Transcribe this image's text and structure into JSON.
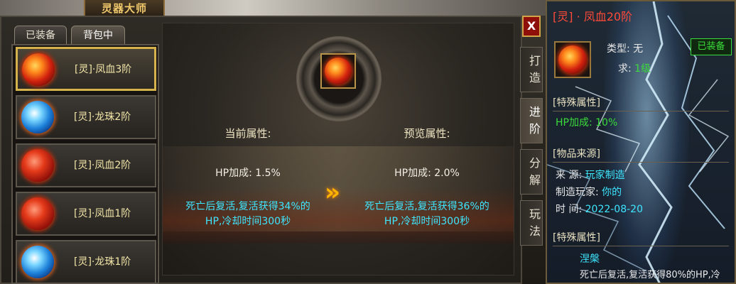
{
  "window": {
    "title": "灵器大师",
    "close_label": "X"
  },
  "tabs": [
    {
      "label": "已装备"
    },
    {
      "label": "背包中"
    }
  ],
  "items": [
    {
      "name": "[灵]·凤血3阶",
      "orb": "red"
    },
    {
      "name": "[灵]·龙珠2阶",
      "orb": "blue"
    },
    {
      "name": "[灵]·凤血2阶",
      "orb": "red"
    },
    {
      "name": "[灵]·凤血1阶",
      "orb": "red"
    },
    {
      "name": "[灵]·龙珠1阶",
      "orb": "blue"
    }
  ],
  "upgrade": {
    "current_header": "当前属性:",
    "preview_header": "预览属性:",
    "current_hp": "HP加成: 1.5%",
    "preview_hp": "HP加成: 2.0%",
    "current_desc_1": "死亡后复活,复活获得34%的",
    "current_desc_2": "HP,冷却时间300秒",
    "preview_desc_1": "死亡后复活,复活获得36%的",
    "preview_desc_2": "HP,冷却时间300秒",
    "arrow": "»"
  },
  "side_menu": [
    "打造",
    "进阶",
    "分解",
    "玩法"
  ],
  "tooltip": {
    "title": "[灵] · 凤血20阶",
    "type_label": "类型: 无",
    "level_prefix": "求: ",
    "level_value": "1级",
    "equipped": "已装备",
    "special_header": "[特殊属性]",
    "hp_bonus": "HP加成: 10%",
    "source_header": "[物品来源]",
    "source_label": "来   源: ",
    "source_value": "玩家制造",
    "maker_label": "制造玩家: ",
    "maker_value": "你的",
    "time_label": "时      间: ",
    "time_value": "2022-08-20",
    "special_header_2": "[特殊属性]",
    "nirvana": "涅槃",
    "nirvana_desc": "死亡后复活,复活获得80%的HP,冷"
  },
  "colors": {
    "gold": "#f2e6a8",
    "cyan": "#3ee6ff",
    "green": "#3adb3a",
    "title_red": "#ff4a3a"
  }
}
